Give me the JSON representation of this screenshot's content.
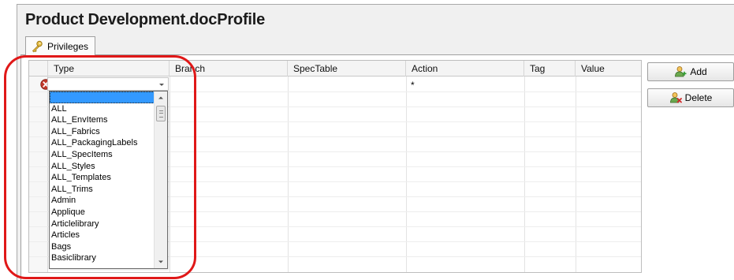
{
  "window": {
    "title": "Product Development.docProfile"
  },
  "tabs": [
    {
      "label": "Privileges",
      "icon": "key-icon"
    }
  ],
  "grid": {
    "columns": [
      "Type",
      "Branch",
      "SpecTable",
      "Action",
      "Tag",
      "Value"
    ],
    "new_row": {
      "type": "",
      "branch": "",
      "spectable": "",
      "action": "*",
      "tag": "",
      "value": ""
    }
  },
  "dropdown": {
    "options": [
      "",
      "ALL",
      "ALL_EnvItems",
      "ALL_Fabrics",
      "ALL_PackagingLabels",
      "ALL_SpecItems",
      "ALL_Styles",
      "ALL_Templates",
      "ALL_Trims",
      "Admin",
      "Applique",
      "Articlelibrary",
      "Articles",
      "Bags",
      "Basiclibrary"
    ],
    "selected_index": 0
  },
  "buttons": {
    "add": {
      "label": "Add",
      "icon": "add-user-icon"
    },
    "delete": {
      "label": "Delete",
      "icon": "delete-user-icon"
    }
  },
  "colors": {
    "highlight": "#e01818",
    "selection": "#3399ff",
    "error": "#c0392b"
  }
}
